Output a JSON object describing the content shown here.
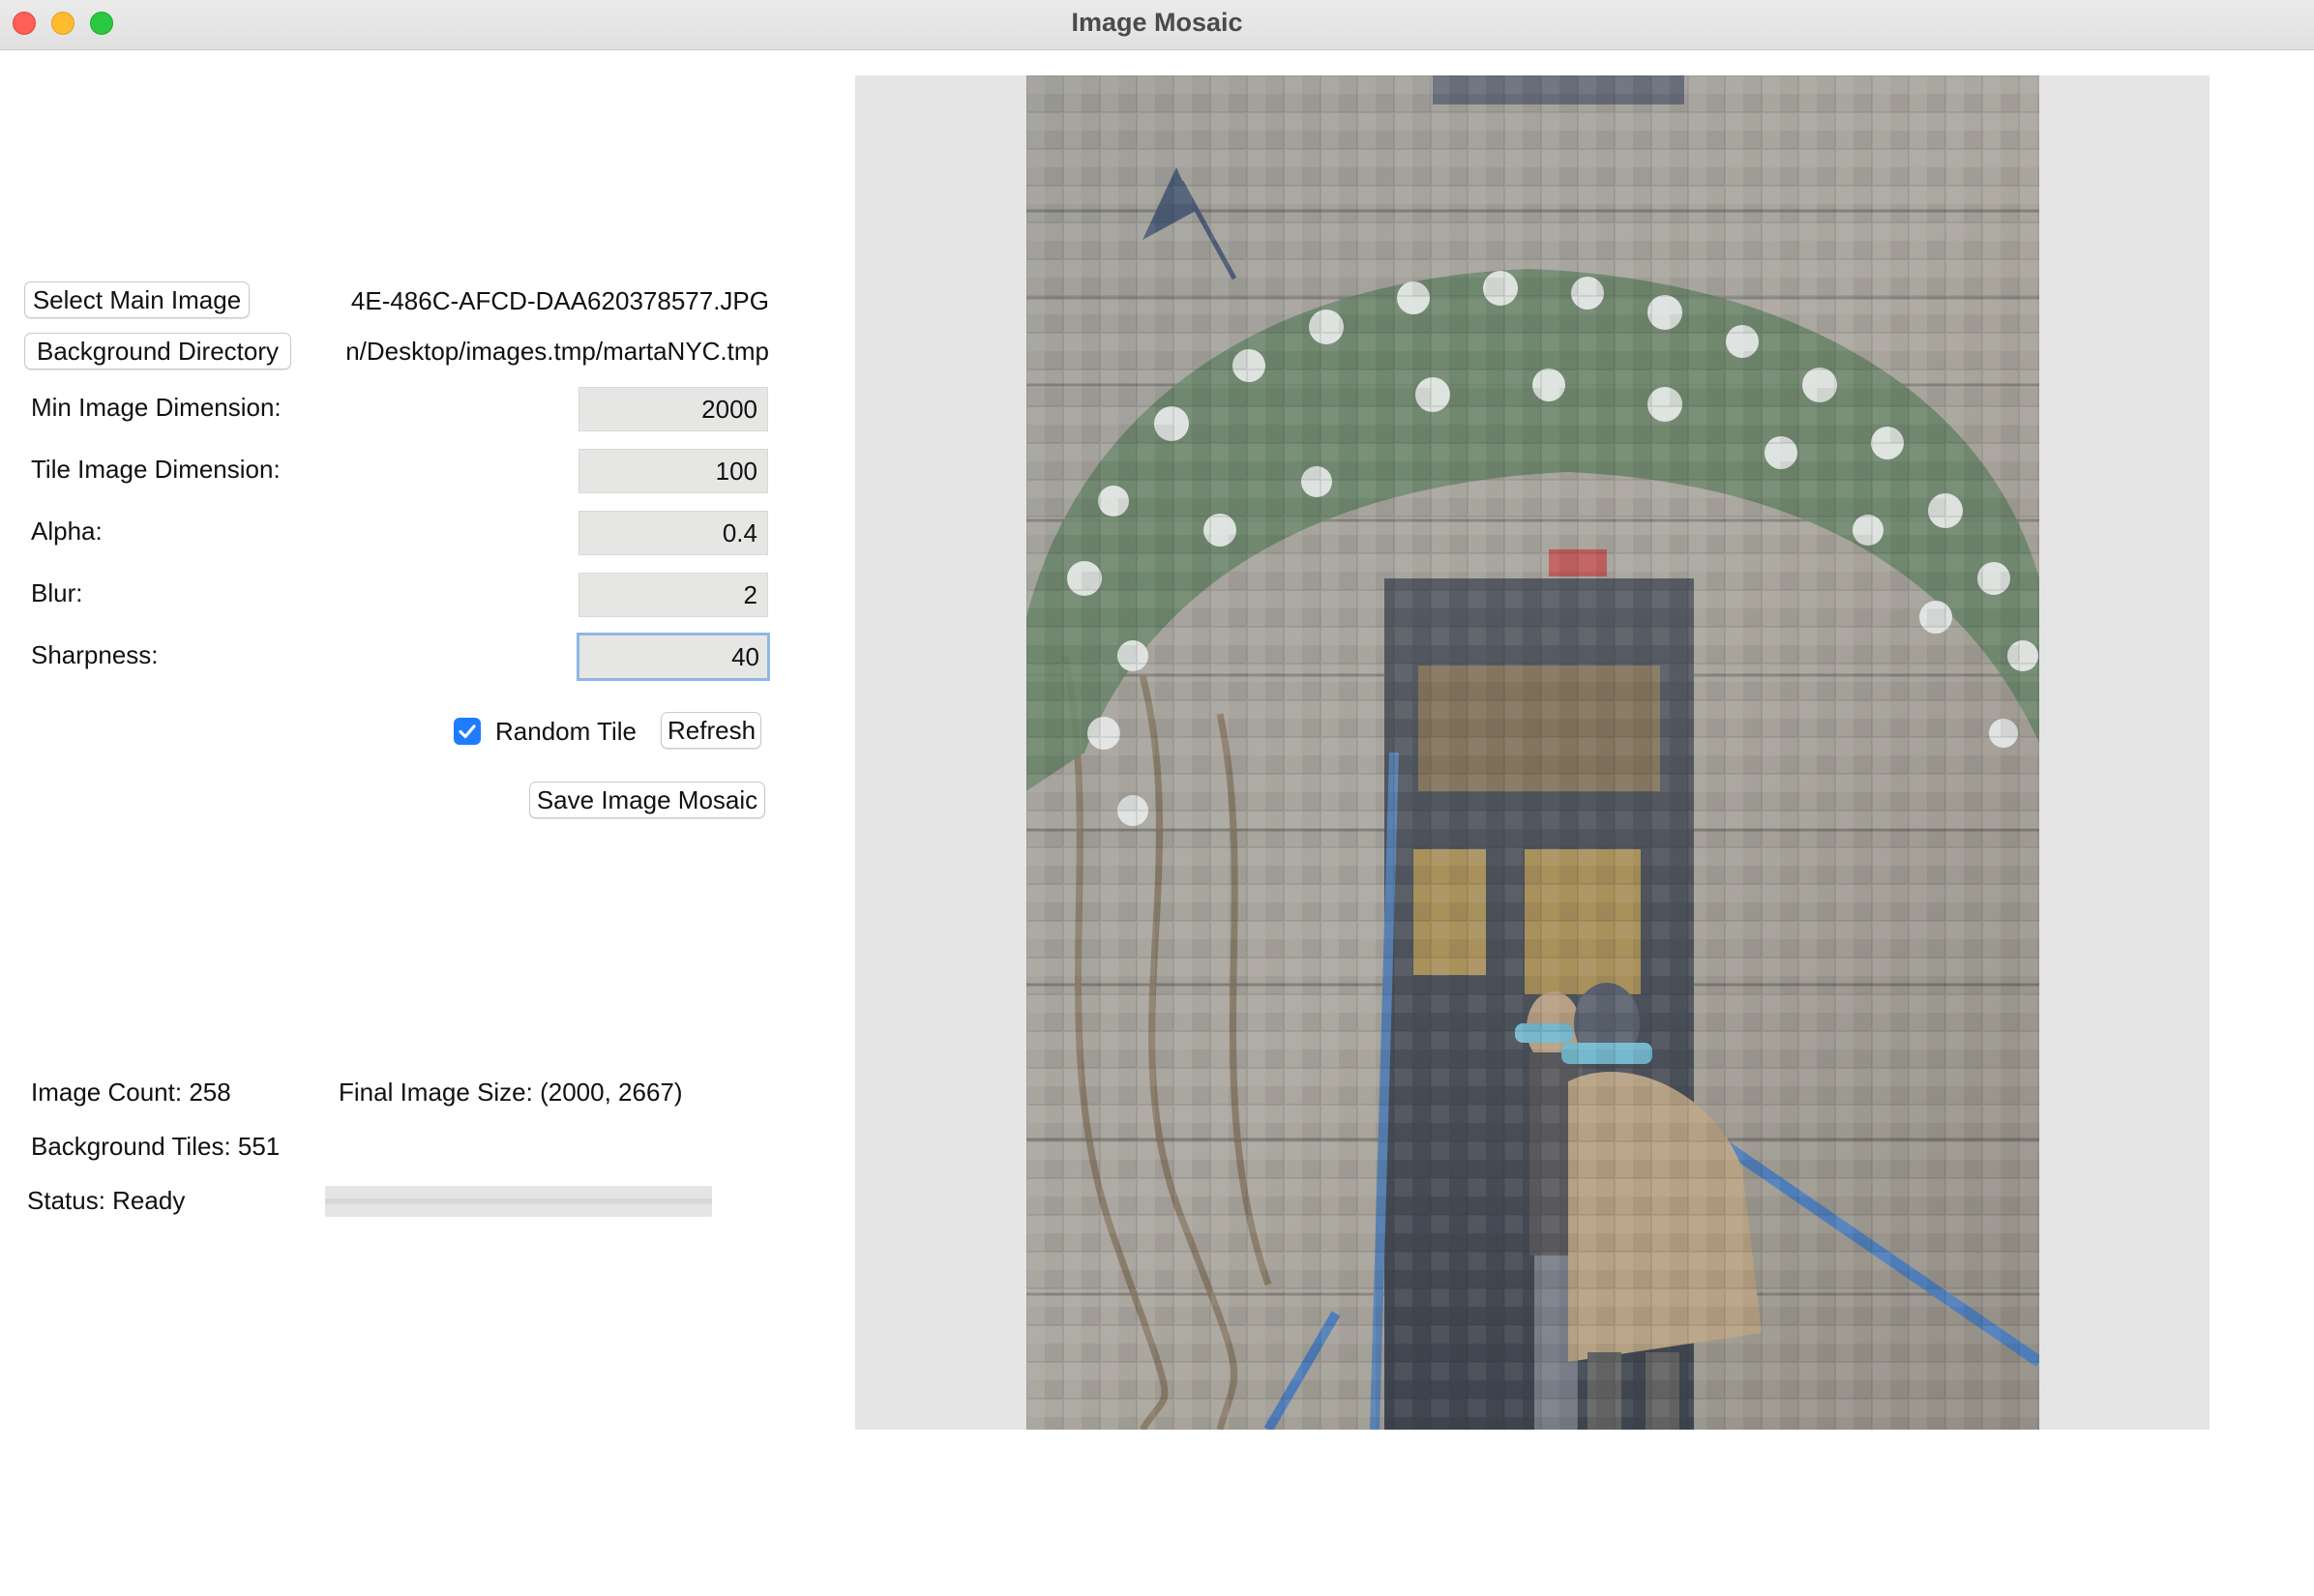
{
  "window": {
    "title": "Image Mosaic"
  },
  "controls": {
    "select_main_image_label": "Select Main Image",
    "main_image_path": "4E-486C-AFCD-DAA620378577.JPG",
    "background_directory_label": "Background Directory",
    "background_directory_path": "n/Desktop/images.tmp/martaNYC.tmp",
    "min_image_dimension_label": "Min Image Dimension:",
    "min_image_dimension_value": "2000",
    "tile_image_dimension_label": "Tile Image Dimension:",
    "tile_image_dimension_value": "100",
    "alpha_label": "Alpha:",
    "alpha_value": "0.4",
    "blur_label": "Blur:",
    "blur_value": "2",
    "sharpness_label": "Sharpness:",
    "sharpness_value": "40",
    "random_tile_label": "Random Tile",
    "random_tile_checked": true,
    "refresh_label": "Refresh",
    "save_label": "Save Image Mosaic"
  },
  "stats": {
    "image_count": "Image Count: 258",
    "final_image_size": "Final Image Size: (2000, 2667)",
    "background_tiles": "Background Tiles: 551",
    "status": "Status: Ready",
    "progress": 0
  },
  "colors": {
    "accent": "#1f7bff",
    "focus_ring": "#8fb6e8",
    "field_bg": "#e6e6e4",
    "preview_bg": "#e5e5e5"
  },
  "preview": {
    "icon": "mosaic-photo"
  }
}
